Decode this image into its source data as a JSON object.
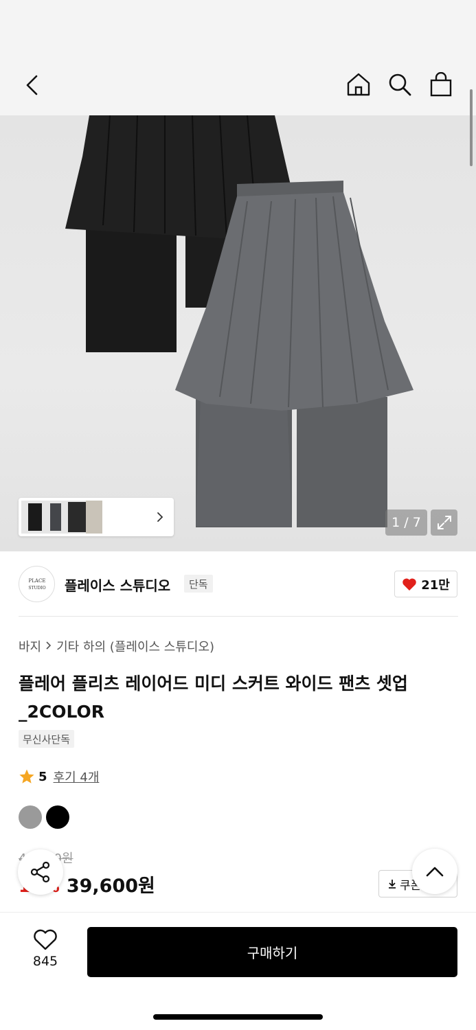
{
  "hero": {
    "counter": "1 / 7"
  },
  "brand": {
    "logo_text": "PLACE STUDIO",
    "name": "플레이스 스튜디오",
    "badge": "단독",
    "likes": "21만"
  },
  "breadcrumb": {
    "category": "바지",
    "subcategory": "기타 하의 (플레이스 스튜디오)"
  },
  "product": {
    "title": "플레어 플리츠 레이어드 미디 스커트 와이드 팬츠 셋업_2COLOR",
    "exclusive": "무신사단독",
    "rating": "5",
    "reviews": "후기 4개",
    "colors": [
      "#9a9a9a",
      "#000000"
    ],
    "original_price": "44,000원",
    "discount": "10%",
    "price": "39,600원",
    "coupon": "쿠폰"
  },
  "bottom": {
    "wish_count": "845",
    "buy_label": "구매하기"
  },
  "accent": {
    "red": "#e1211b",
    "star": "#f5a623"
  }
}
